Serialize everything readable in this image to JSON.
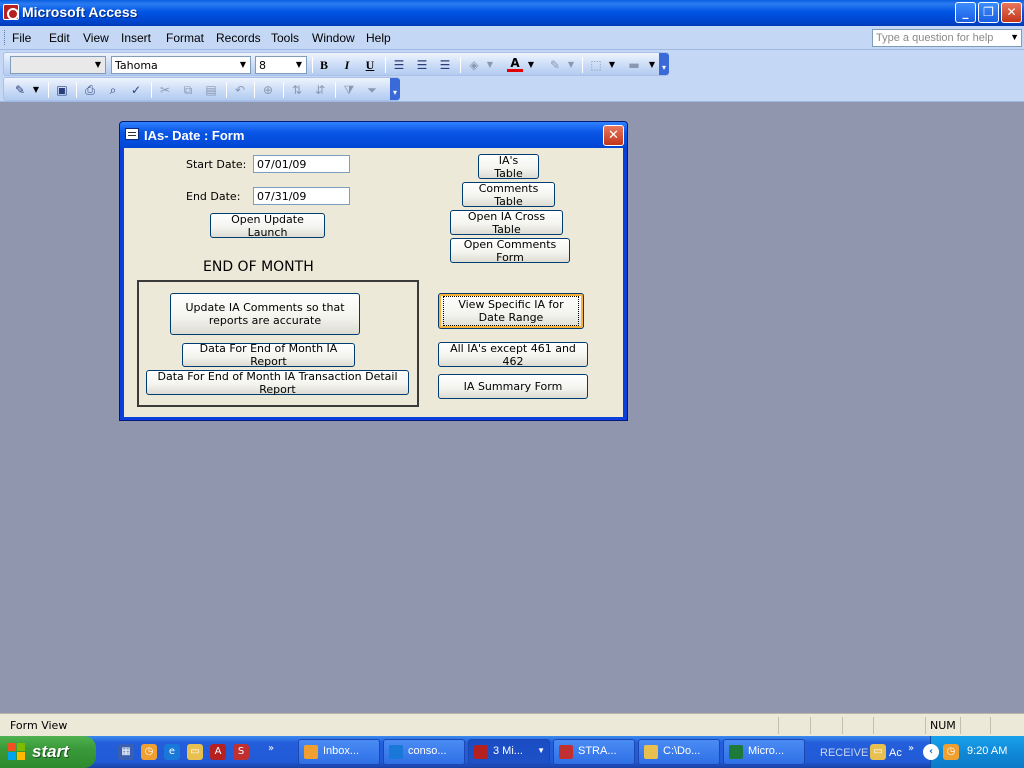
{
  "window": {
    "title": "Microsoft Access",
    "minimize": "_",
    "maximize": "❐",
    "close": "✕"
  },
  "menu": {
    "items": [
      "File",
      "Edit",
      "View",
      "Insert",
      "Format",
      "Records",
      "Tools",
      "Window",
      "Help"
    ],
    "help_placeholder": "Type a question for help"
  },
  "toolbar": {
    "object_combo": "",
    "font_combo": "Tahoma",
    "size_combo": "8",
    "bold": "B",
    "italic": "I",
    "underline": "U"
  },
  "form": {
    "title": "IAs- Date : Form",
    "start_date_label": "Start Date:",
    "start_date_value": "07/01/09",
    "end_date_label": "End Date:",
    "end_date_value": "07/31/09",
    "open_update_launch": "Open Update Launch",
    "section_heading": "END OF MONTH",
    "update_comments": "Update IA Comments so that reports are accurate",
    "data_eom_ia_report": "Data For End of Month IA Report",
    "data_eom_transaction": "Data For End of Month IA Transaction Detail Report",
    "ias_table": "IA's Table",
    "comments_table": "Comments Table",
    "open_ia_cross_table": "Open IA Cross Table",
    "open_comments_form": "Open Comments Form",
    "view_specific_ia": "View Specific IA for Date Range",
    "all_ias_except": "All IA's except 461 and 462",
    "ia_summary_form": "IA Summary Form"
  },
  "status": {
    "text": "Form View",
    "num": "NUM"
  },
  "taskbar": {
    "start": "start",
    "tasks": [
      "Inbox...",
      "conso...",
      "3 Mi...",
      "STRA...",
      "C:\\Do...",
      "Micro...",
      "RECEIVE",
      "Ac"
    ],
    "clock": "9:20 AM"
  },
  "colors": {
    "titlebar": "#0055e5",
    "desktop": "#8f96ae",
    "form_bg": "#ece9d8",
    "focus": "#f8b33a"
  }
}
